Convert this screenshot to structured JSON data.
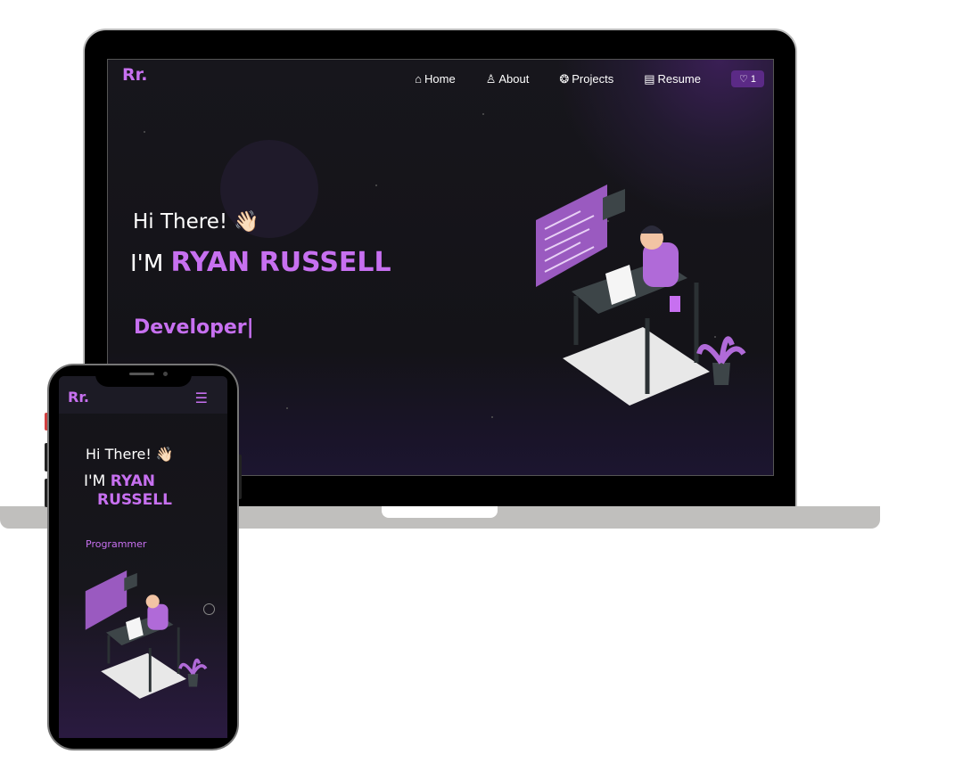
{
  "desktop": {
    "logo": "Rr.",
    "nav": [
      {
        "label": "Home",
        "icon": "home-icon",
        "glyph": "⌂"
      },
      {
        "label": "About",
        "icon": "user-icon",
        "glyph": "♙"
      },
      {
        "label": "Projects",
        "icon": "projects-icon",
        "glyph": "❂"
      },
      {
        "label": "Resume",
        "icon": "document-icon",
        "glyph": "▤"
      }
    ],
    "fork": {
      "icon": "heart-icon",
      "glyph": "♡",
      "count": "1"
    },
    "greeting": "Hi There! 👋🏻",
    "im": "I'M",
    "name": "RYAN RUSSELL",
    "role": "Developer|"
  },
  "mobile": {
    "logo": "Rr.",
    "menu_glyph": "☰",
    "greeting": "Hi There! 👋🏻",
    "im": "I'M",
    "name_line1": "RYAN",
    "name_line2": "RUSSELL",
    "role": "Programmer"
  },
  "colors": {
    "accent": "#c770f0",
    "background": "#141318"
  }
}
